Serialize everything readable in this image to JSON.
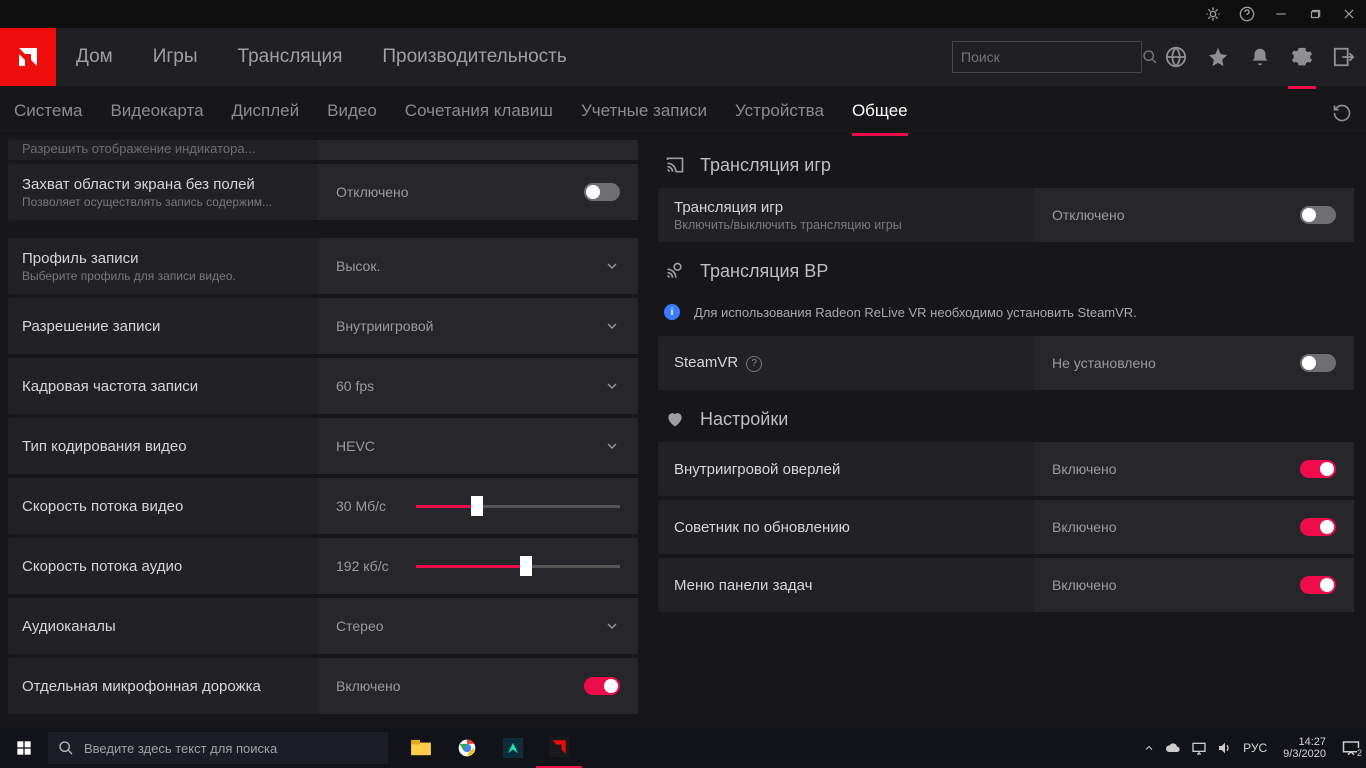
{
  "titlebar": {
    "icons": [
      "bug-icon",
      "help-icon",
      "minimize-icon",
      "restore-icon",
      "close-icon"
    ]
  },
  "topnav": {
    "tabs": [
      "Дом",
      "Игры",
      "Трансляция",
      "Производительность"
    ],
    "search_placeholder": "Поиск"
  },
  "subnav": {
    "tabs": [
      "Система",
      "Видеокарта",
      "Дисплей",
      "Видео",
      "Сочетания клавиш",
      "Учетные записи",
      "Устройства",
      "Общее"
    ],
    "active_index": 7
  },
  "left": {
    "row0": {
      "title": "Разрешить отображение индикатора",
      "title_truncated": "Разрешить отображение индикатора..."
    },
    "row1": {
      "title": "Захват области экрана без полей",
      "sub": "Позволяет осуществлять запись содержим...",
      "value": "Отключено",
      "toggle_on": false
    },
    "rows": [
      {
        "title": "Профиль записи",
        "sub": "Выберите профиль для записи видео.",
        "value": "Высок.",
        "type": "select"
      },
      {
        "title": "Разрешение записи",
        "value": "Внутриигровой",
        "type": "select"
      },
      {
        "title": "Кадровая частота записи",
        "value": "60 fps",
        "type": "select"
      },
      {
        "title": "Тип кодирования видео",
        "value": "HEVC",
        "type": "select"
      },
      {
        "title": "Скорость потока видео",
        "value": "30 Мб/с",
        "type": "slider",
        "pct": 30
      },
      {
        "title": "Скорость потока аудио",
        "value": "192 кб/с",
        "type": "slider",
        "pct": 54
      },
      {
        "title": "Аудиоканалы",
        "value": "Стерео",
        "type": "select"
      },
      {
        "title": "Отдельная микрофонная дорожка",
        "value": "Включено",
        "type": "toggle",
        "on": true
      }
    ]
  },
  "right": {
    "section1": {
      "title": "Трансляция игр"
    },
    "row1": {
      "title": "Трансляция игр",
      "sub": "Включить/выключить трансляцию игры",
      "value": "Отключено",
      "on": false
    },
    "section2": {
      "title": "Трансляция ВР"
    },
    "info": "Для использования Radeon ReLive VR необходимо установить SteamVR.",
    "row2": {
      "title": "SteamVR",
      "value": "Не установлено",
      "on": false,
      "help": true
    },
    "section3": {
      "title": "Настройки"
    },
    "rows3": [
      {
        "title": "Внутриигровой оверлей",
        "value": "Включено",
        "on": true
      },
      {
        "title": "Советник по обновлению",
        "value": "Включено",
        "on": true
      },
      {
        "title": "Меню панели задач",
        "value": "Включено",
        "on": true
      }
    ]
  },
  "taskbar": {
    "search_placeholder": "Введите здесь текст для поиска",
    "lang": "РУС",
    "time": "14:27",
    "date": "9/3/2020",
    "notifications": "2"
  }
}
